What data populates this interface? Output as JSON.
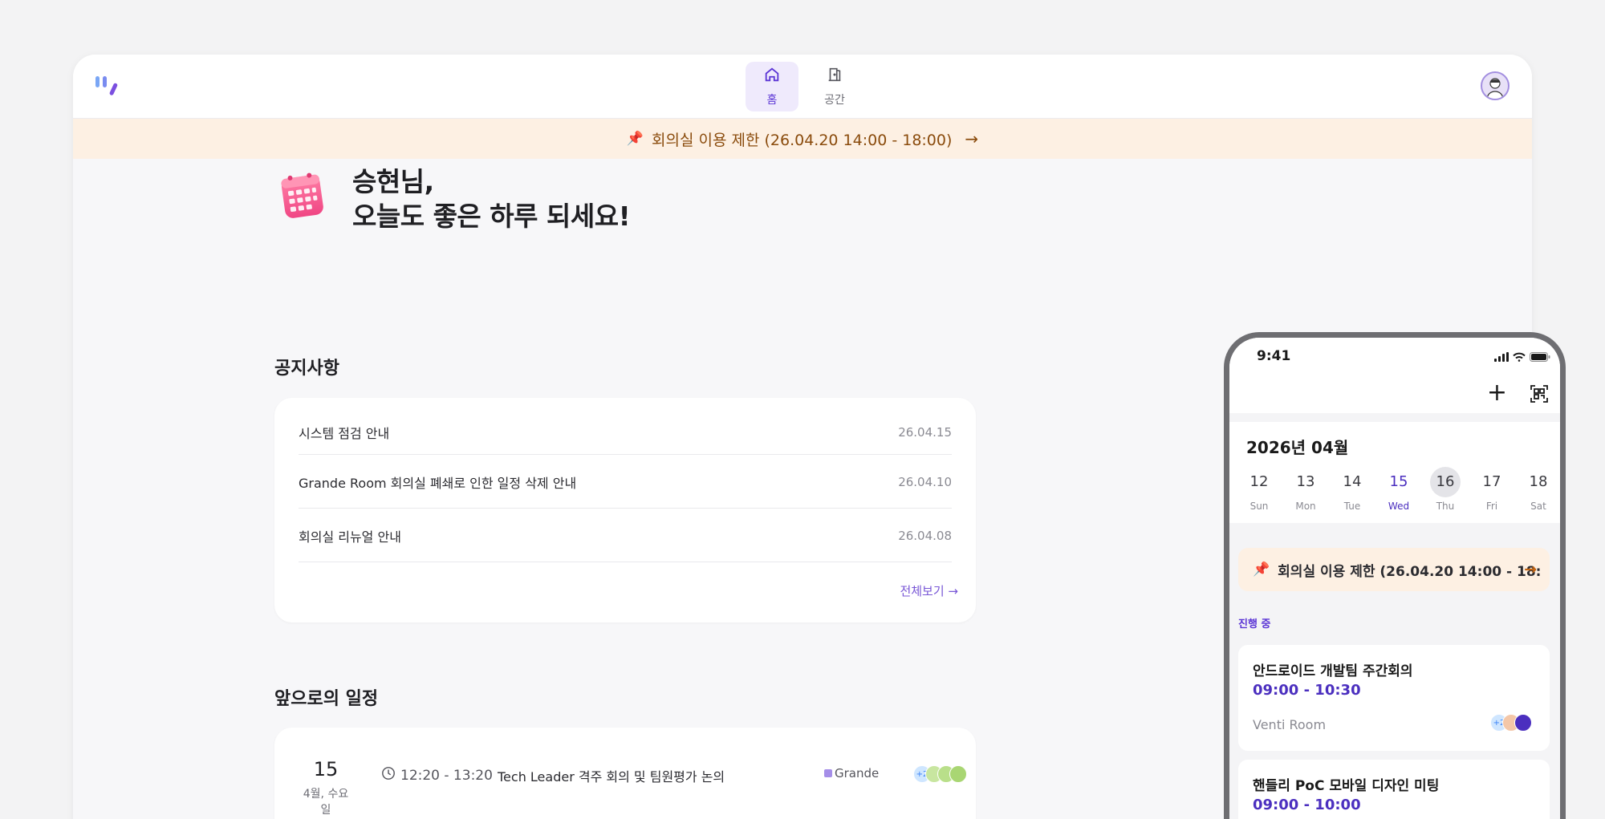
{
  "nav": {
    "tabs": [
      {
        "label": "홈",
        "icon": "home-icon",
        "active": true
      },
      {
        "label": "공간",
        "icon": "door-icon",
        "active": false
      }
    ]
  },
  "banner": {
    "text": "회의실 이용 제한 (26.04.20 14:00 - 18:00)",
    "icon": "pin-icon"
  },
  "greeting": {
    "line1": "승현님,",
    "line2": "오늘도 좋은 하루 되세요!"
  },
  "notices": {
    "title": "공지사항",
    "items": [
      {
        "title": "시스템 점검 안내",
        "date": "26.04.15"
      },
      {
        "title": "Grande Room 회의실 폐쇄로 인한 일정 삭제 안내",
        "date": "26.04.10"
      },
      {
        "title": "회의실 리뉴얼 안내",
        "date": "26.04.08"
      }
    ],
    "view_all": "전체보기 →"
  },
  "schedule": {
    "title": "앞으로의 일정",
    "items": [
      {
        "day": "15",
        "weekday": "4월, 수요일",
        "time": "12:20 - 13:20",
        "title": "Tech Leader 격주 회의 및 팀원평가 논의",
        "room": "Grande",
        "extra": "+2"
      }
    ]
  },
  "phone": {
    "time": "9:41",
    "month": "2026년 04월",
    "days": [
      {
        "n": "12",
        "w": "Sun"
      },
      {
        "n": "13",
        "w": "Mon"
      },
      {
        "n": "14",
        "w": "Tue"
      },
      {
        "n": "15",
        "w": "Wed"
      },
      {
        "n": "16",
        "w": "Thu"
      },
      {
        "n": "17",
        "w": "Fri"
      },
      {
        "n": "18",
        "w": "Sat"
      }
    ],
    "selected_day": "15",
    "today": "16",
    "banner": "회의실 이용 제한 (26.04.20 14:00 - 18:",
    "section_label": "진행 중",
    "meetings": [
      {
        "title": "안드로이드 개발팀 주간회의",
        "time": "09:00 - 10:30",
        "room": "Venti Room",
        "extra": "+2"
      },
      {
        "title": "핸들리 PoC 모바일 디자인 미팅",
        "time": "09:00 - 10:00",
        "room": "",
        "extra": ""
      }
    ]
  },
  "colors": {
    "accent": "#5b35d5",
    "banner_bg": "#fdf0e3",
    "banner_text": "#8a4b0c"
  }
}
